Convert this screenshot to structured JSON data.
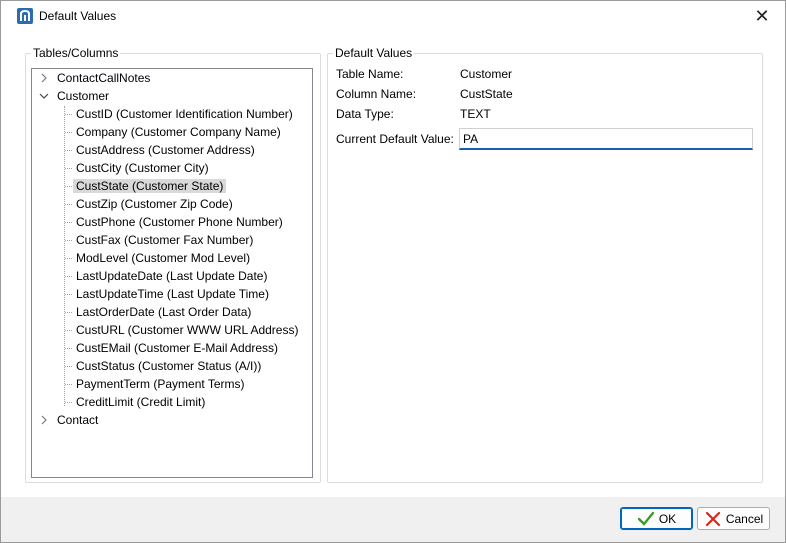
{
  "window": {
    "title": "Default Values",
    "close_glyph": "✕",
    "icon": "app-icon"
  },
  "tables_group": {
    "legend": "Tables/Columns",
    "tree": {
      "nodes": [
        {
          "label": "ContactCallNotes",
          "expanded": false,
          "expander_glyph": "›"
        },
        {
          "label": "Customer",
          "expanded": true,
          "expander_glyph": "⌄",
          "children": [
            {
              "label": "CustID  (Customer Identification Number)"
            },
            {
              "label": "Company  (Customer Company Name)"
            },
            {
              "label": "CustAddress  (Customer Address)"
            },
            {
              "label": "CustCity  (Customer City)"
            },
            {
              "label": "CustState  (Customer State)",
              "selected": true
            },
            {
              "label": "CustZip  (Customer Zip Code)"
            },
            {
              "label": "CustPhone  (Customer Phone Number)"
            },
            {
              "label": "CustFax  (Customer Fax Number)"
            },
            {
              "label": "ModLevel  (Customer Mod Level)"
            },
            {
              "label": "LastUpdateDate  (Last Update Date)"
            },
            {
              "label": "LastUpdateTime  (Last Update Time)"
            },
            {
              "label": "LastOrderDate  (Last Order Data)"
            },
            {
              "label": "CustURL  (Customer WWW URL Address)"
            },
            {
              "label": "CustEMail  (Customer E-Mail Address)"
            },
            {
              "label": "CustStatus  (Customer Status (A/I))"
            },
            {
              "label": "PaymentTerm  (Payment Terms)"
            },
            {
              "label": "CreditLimit  (Credit Limit)"
            }
          ]
        },
        {
          "label": "Contact",
          "expanded": false,
          "expander_glyph": "›"
        }
      ]
    }
  },
  "defaults_group": {
    "legend": "Default Values",
    "table_name_label": "Table Name:",
    "table_name_value": "Customer",
    "column_name_label": "Column Name:",
    "column_name_value": "CustState",
    "data_type_label": "Data Type:",
    "data_type_value": "TEXT",
    "current_default_label": "Current Default Value:",
    "current_default_value": "PA"
  },
  "buttons": {
    "ok_label": "OK",
    "cancel_label": "Cancel",
    "ok_icon": "checkmark-icon",
    "cancel_icon": "x-icon"
  },
  "colors": {
    "selection": "#d9d9d9",
    "focus_underline": "#1a5fb4",
    "ok_check": "#3a9d23",
    "cancel_x": "#d9261c",
    "app_icon": "#2b6cb0"
  }
}
